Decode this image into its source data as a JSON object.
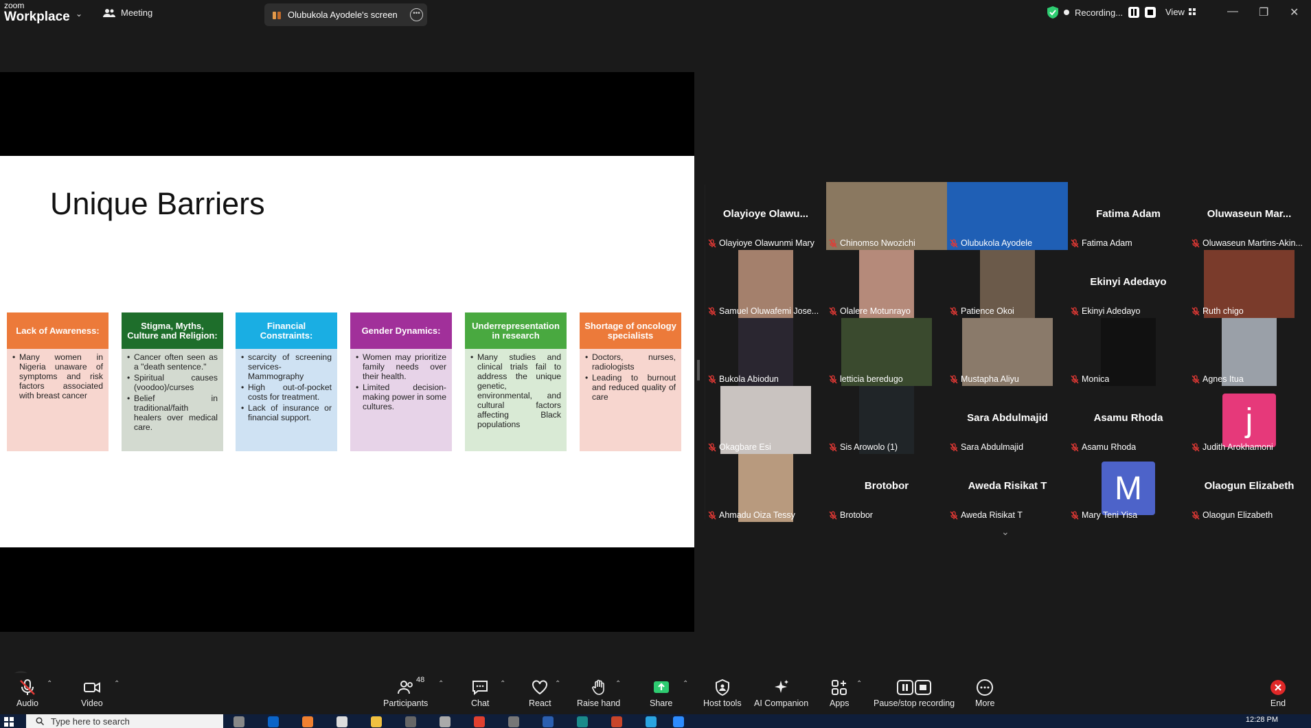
{
  "app": {
    "brand_small": "zoom",
    "brand_big": "Workplace",
    "meeting_label": "Meeting"
  },
  "share_pill": {
    "label": "Olubukola Ayodele's screen"
  },
  "recording": {
    "label": "Recording..."
  },
  "view": {
    "label": "View"
  },
  "slide": {
    "title": "Unique Barriers",
    "barriers": [
      {
        "title": "Lack of Awareness:",
        "head_color": "#ec7a3a",
        "body_color": "#f7d6cf",
        "points": [
          "Many women in Nigeria unaware of symptoms and risk factors associated with breast cancer"
        ]
      },
      {
        "title": "Stigma, Myths, Culture and Religion:",
        "head_color": "#1e6e2b",
        "body_color": "#d3dad0",
        "points": [
          "Cancer often seen as a \"death sentence.\"",
          "Spiritual causes (voodoo)/curses",
          "Belief in traditional/faith healers over medical care."
        ]
      },
      {
        "title": "Financial Constraints:",
        "head_color": "#1aaee3",
        "body_color": "#cfe2f3",
        "points": [
          "scarcity of screening services- Mammography",
          "High out-of-pocket costs for treatment.",
          "Lack of insurance or financial support."
        ]
      },
      {
        "title": "Gender Dynamics:",
        "head_color": "#a1309a",
        "body_color": "#e7d3e8",
        "points": [
          "Women may prioritize family needs over their health.",
          "Limited decision-making power in some cultures."
        ]
      },
      {
        "title": "Underrepresentation in research",
        "head_color": "#49a940",
        "body_color": "#d9ead5",
        "points": [
          "Many studies and clinical trials fail to address the unique genetic, environmental, and cultural factors affecting Black populations"
        ]
      },
      {
        "title": "Shortage of oncology specialists",
        "head_color": "#ec7a3a",
        "body_color": "#f7d6cf",
        "points": [
          "Doctors, nurses, radiologists",
          "Leading to burnout and reduced quality of care"
        ]
      }
    ]
  },
  "participants": [
    {
      "name": "Olayioye Olawunmi Mary",
      "display": "Olayioye Olawu...",
      "type": "name"
    },
    {
      "name": "Chinomso Nwozichi",
      "type": "video",
      "bg": "#8a7860"
    },
    {
      "name": "Olubukola Ayodele",
      "type": "video-active",
      "bg": "#1f5fb5"
    },
    {
      "name": "Fatima Adam",
      "display": "Fatima Adam",
      "type": "name"
    },
    {
      "name": "Oluwaseun Martins-Akin...",
      "display": "Oluwaseun Mar...",
      "type": "name"
    },
    {
      "name": "Samuel Oluwafemi Jose...",
      "type": "video-small",
      "bg": "#a4806c"
    },
    {
      "name": "Olalere Motunrayo",
      "type": "video-small",
      "bg": "#b58a7a"
    },
    {
      "name": "Patience Okoi",
      "type": "video-small",
      "bg": "#6b5a4a"
    },
    {
      "name": "Ekinyi Adedayo",
      "display": "Ekinyi Adedayo",
      "type": "name"
    },
    {
      "name": "Ruth chigo",
      "type": "video-wide",
      "bg": "#7a3b2b"
    },
    {
      "name": "Bukola Abiodun",
      "type": "video-small",
      "bg": "#2a2630"
    },
    {
      "name": "letticia beredugo",
      "type": "video-wide",
      "bg": "#3a4a2e"
    },
    {
      "name": "Mustapha Aliyu",
      "type": "video-wide",
      "bg": "#8a7a6a"
    },
    {
      "name": "Monica",
      "type": "video-small",
      "bg": "#111111"
    },
    {
      "name": "Agnes Itua",
      "type": "video-small",
      "bg": "#9aa0a8"
    },
    {
      "name": "Okagbare Esi",
      "type": "video-wide",
      "bg": "#c9c3c0"
    },
    {
      "name": "Sis Arowolo (1)",
      "type": "video-small",
      "bg": "#202528"
    },
    {
      "name": "Sara Abdulmajid",
      "display": "Sara Abdulmajid",
      "type": "name"
    },
    {
      "name": "Asamu Rhoda",
      "display": "Asamu Rhoda",
      "type": "name"
    },
    {
      "name": "Judith Arokhamoni",
      "type": "letter",
      "letter": "j",
      "bg": "#e6397a"
    },
    {
      "name": "Ahmadu Oiza Tessy",
      "type": "video-small",
      "bg": "#b89a7e"
    },
    {
      "name": "Brotobor",
      "display": "Brotobor",
      "type": "name"
    },
    {
      "name": "Aweda Risikat T",
      "display": "Aweda Risikat T",
      "type": "name"
    },
    {
      "name": "Mary Teni Yisa",
      "type": "letter",
      "letter": "M",
      "bg": "#4d63c9"
    },
    {
      "name": "Olaogun Elizabeth",
      "display": "Olaogun Elizabeth",
      "type": "name"
    }
  ],
  "toolbar": {
    "audio": "Audio",
    "video": "Video",
    "participants": "Participants",
    "participants_count": "48",
    "chat": "Chat",
    "react": "React",
    "raise_hand": "Raise hand",
    "share": "Share",
    "host_tools": "Host tools",
    "ai_companion": "AI Companion",
    "apps": "Apps",
    "pause_stop": "Pause/stop recording",
    "more": "More",
    "end": "End"
  },
  "taskbar": {
    "search_placeholder": "Type here to search",
    "time": "12:28 PM"
  },
  "colors": {
    "accent_green": "#2ed47a",
    "share_green": "#2ecc71",
    "end_red": "#e02828",
    "mute_red": "#e53935"
  }
}
